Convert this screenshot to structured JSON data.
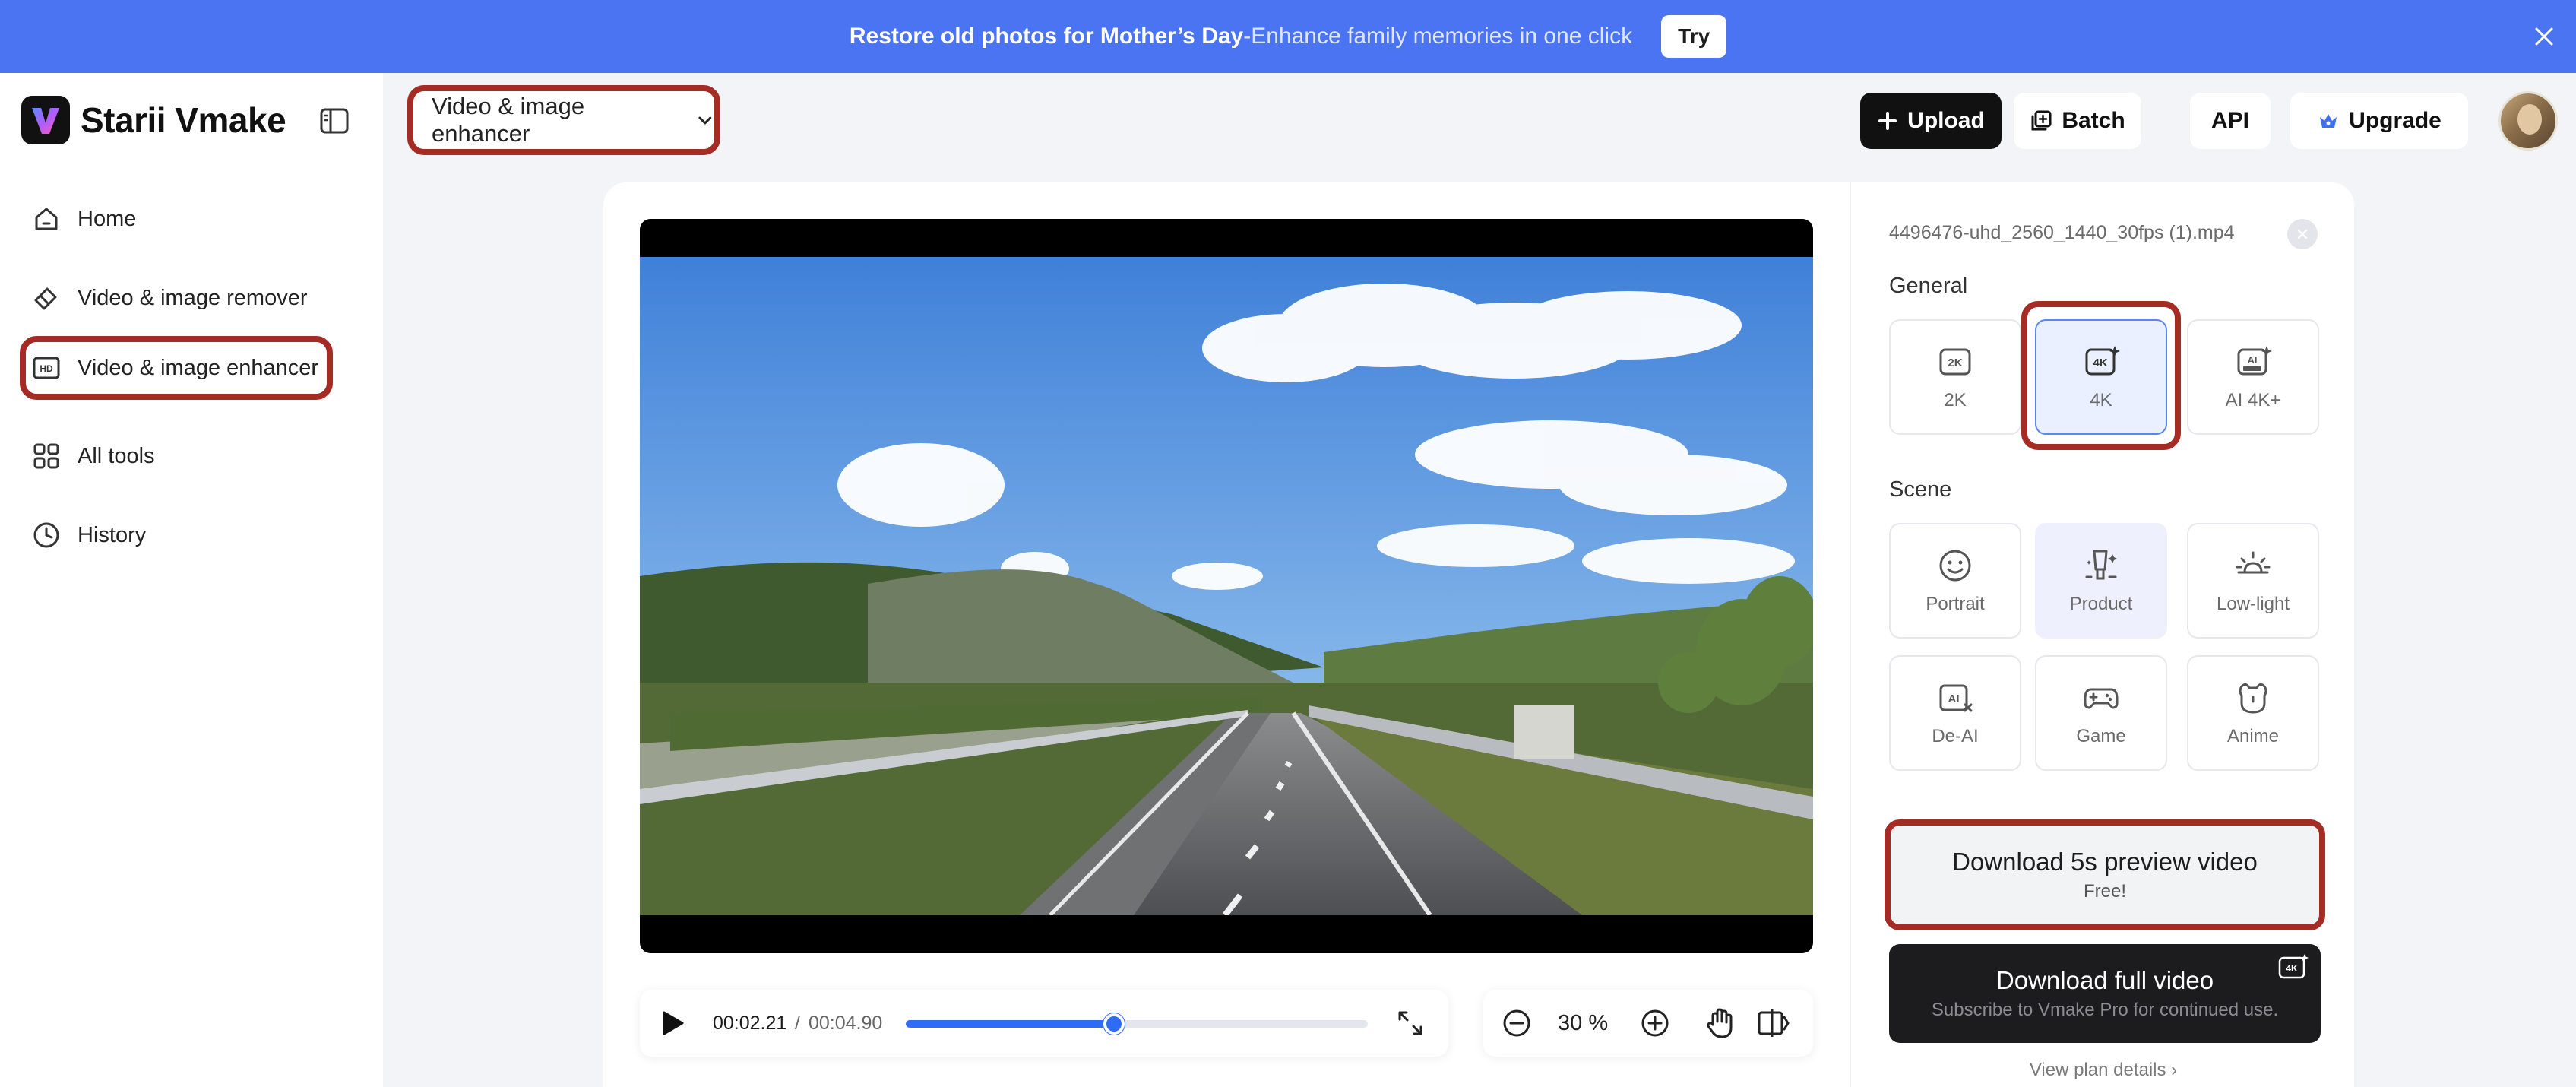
{
  "banner": {
    "strong": "Restore old photos for Mother’s Day",
    "light": " -Enhance family memories in one click",
    "try_label": "Try",
    "color": "#4b74f2"
  },
  "sidebar": {
    "brand": "Starii Vmake",
    "items": [
      {
        "label": "Home",
        "icon": "home-icon"
      },
      {
        "label": "Video & image remover",
        "icon": "eraser-icon"
      },
      {
        "label": "Video & image enhancer",
        "icon": "hd-icon",
        "active": true
      },
      {
        "label": "All tools",
        "icon": "grid-icon"
      },
      {
        "label": "History",
        "icon": "clock-icon"
      }
    ]
  },
  "header": {
    "tool_select": "Video & image enhancer",
    "upload": "Upload",
    "batch": "Batch",
    "api": "API",
    "upgrade": "Upgrade"
  },
  "player": {
    "current": "00:02.21",
    "separator": "/",
    "total": "00:04.90",
    "progress": 0.45,
    "zoom": "30 %"
  },
  "settings": {
    "file_name": "4496476-uhd_2560_1440_30fps (1).mp4",
    "general_label": "General",
    "general": [
      {
        "label": "2K",
        "icon": "2k-icon"
      },
      {
        "label": "4K",
        "icon": "4k-icon",
        "selected": true
      },
      {
        "label": "AI 4K+",
        "icon": "ai-4k-plus-icon"
      }
    ],
    "scene_label": "Scene",
    "scenes": [
      {
        "label": "Portrait",
        "icon": "smiley-icon"
      },
      {
        "label": "Product",
        "icon": "product-icon",
        "selected": true
      },
      {
        "label": "Low-light",
        "icon": "sunrise-icon"
      },
      {
        "label": "De-AI",
        "icon": "de-ai-icon"
      },
      {
        "label": "Game",
        "icon": "gamepad-icon"
      },
      {
        "label": "Anime",
        "icon": "anime-icon"
      }
    ],
    "download_preview": {
      "title": "Download 5s preview video",
      "sub": "Free!"
    },
    "download_full": {
      "title": "Download full video",
      "sub": "Subscribe to Vmake Pro for continued use."
    },
    "plan_link": "View plan details ›"
  },
  "colors": {
    "accent": "#2f6cf6",
    "highlight_frame": "#a52b25"
  }
}
